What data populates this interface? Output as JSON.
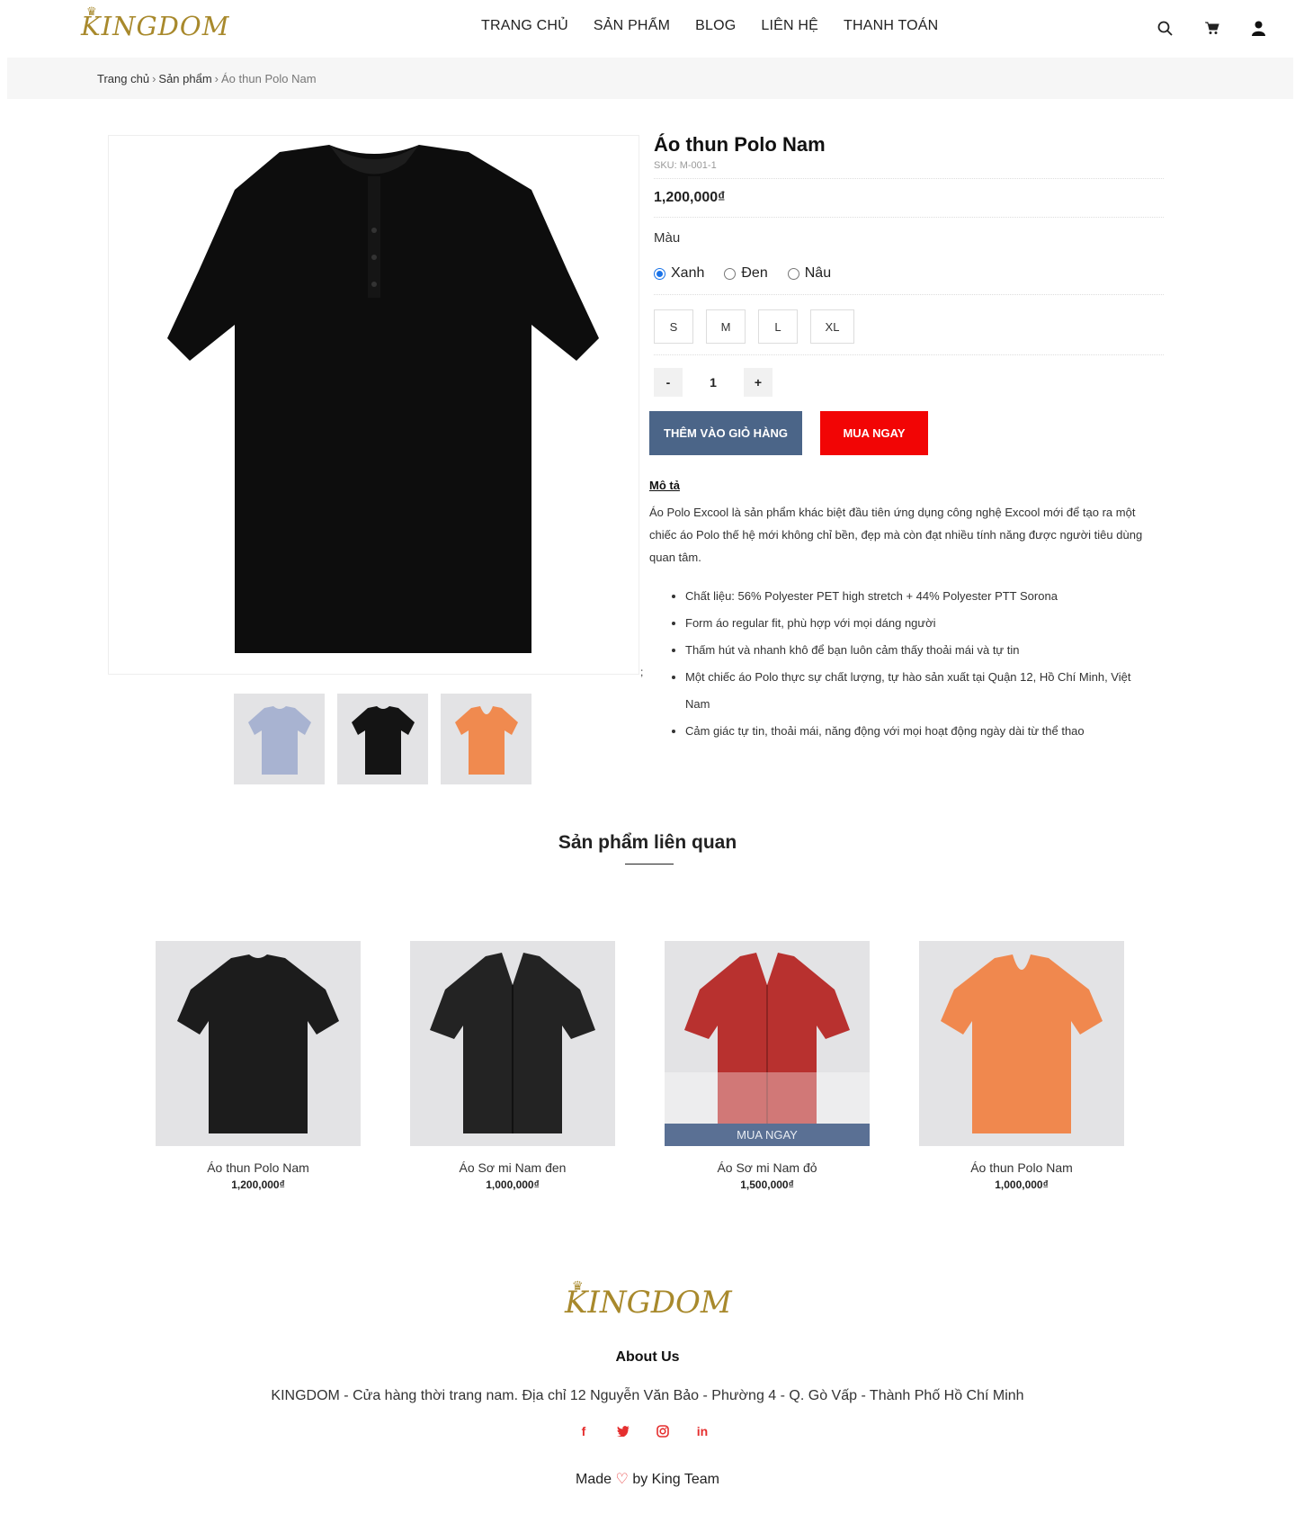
{
  "header": {
    "logo": "KINGDOM",
    "nav": [
      "TRANG CHỦ",
      "SẢN PHẨM",
      "BLOG",
      "LIÊN HỆ",
      "THANH TOÁN"
    ],
    "icons": [
      "search-icon",
      "cart-icon",
      "user-icon"
    ]
  },
  "breadcrumb": {
    "home": "Trang chủ",
    "category": "Sản phẩm",
    "current": "Áo thun Polo Nam"
  },
  "product": {
    "title": "Áo thun Polo Nam",
    "sku": "SKU: M-001-1",
    "price": "1,200,000₫",
    "color_label": "Màu",
    "colors": [
      "Xanh",
      "Đen",
      "Nâu"
    ],
    "selected_color": "Xanh",
    "sizes": [
      "S",
      "M",
      "L",
      "XL"
    ],
    "qty_minus": "-",
    "qty": "1",
    "qty_plus": "+",
    "add_to_cart": "THÊM VÀO GIỎ HÀNG",
    "buy_now": "MUA NGAY",
    "desc_heading": "Mô tả",
    "desc": "Áo Polo Excool là sản phẩm khác biệt đầu tiên ứng dụng công nghệ Excool mới để tạo ra một chiếc áo Polo thế hệ mới không chỉ bền, đẹp mà còn đạt nhiều tính năng được người tiêu dùng quan tâm.",
    "bullets": [
      "Chất liệu: 56% Polyester PET high stretch + 44% Polyester PTT Sorona",
      "Form áo regular fit, phù hợp với mọi dáng người",
      "Thấm hút và nhanh khô để bạn luôn cảm thấy thoải mái và tự tin",
      "Một chiếc áo Polo thực sự chất lượng, tự hào sản xuất tại Quận 12, Hồ Chí Minh, Việt Nam",
      "Cảm giác tự tin, thoải mái, năng động với mọi hoạt động ngày dài từ thể thao"
    ],
    "stray_mark": ";"
  },
  "related": {
    "title": "Sản phẩm liên quan",
    "hover_button": "MUA NGAY",
    "items": [
      {
        "name": "Áo thun Polo Nam",
        "price": "1,200,000₫",
        "color": "#1c1c1c"
      },
      {
        "name": "Áo Sơ mi Nam đen",
        "price": "1,000,000₫",
        "color": "#232323"
      },
      {
        "name": "Áo Sơ mi Nam đỏ",
        "price": "1,500,000₫",
        "color": "#b8312f"
      },
      {
        "name": "Áo thun Polo Nam",
        "price": "1,000,000₫",
        "color": "#f0884e"
      }
    ]
  },
  "footer": {
    "logo": "KINGDOM",
    "about": "About Us",
    "address": "KINGDOM - Cửa hàng thời trang nam. Địa chỉ 12 Nguyễn Văn Bảo - Phường 4 - Q. Gò Vấp - Thành Phố Hồ Chí Minh",
    "socials": [
      "facebook-icon",
      "twitter-icon",
      "instagram-icon",
      "linkedin-icon"
    ],
    "made_prefix": "Made",
    "made_suffix": "by King Team"
  },
  "colors": {
    "accent_blue": "#4b6588",
    "buy_red": "#f20505",
    "gold": "#a8892c"
  }
}
